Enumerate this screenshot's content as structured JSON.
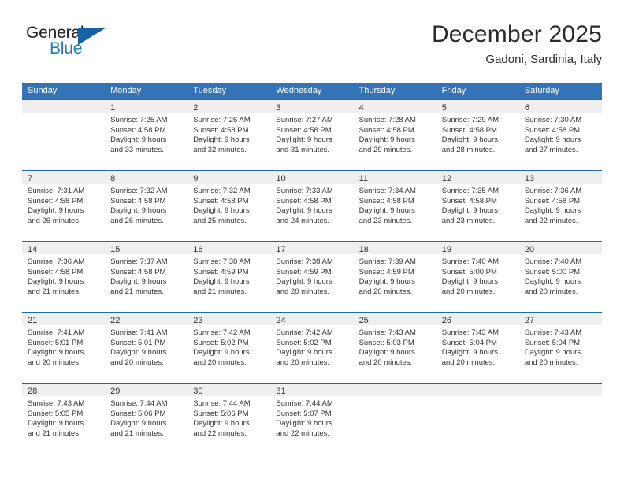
{
  "brand": {
    "word_one": "General",
    "word_two": "Blue",
    "logo_icon": "triangle-logo-icon",
    "accent_color": "#1464a5",
    "blue_text_color": "#1a7bc4"
  },
  "header": {
    "month_title": "December 2025",
    "location": "Gadoni, Sardinia, Italy"
  },
  "colors": {
    "header_row_bg": "#3573b9",
    "row_separator": "#1f6bb0",
    "day_band_bg": "#efefef",
    "text": "#333333"
  },
  "weekdays": [
    "Sunday",
    "Monday",
    "Tuesday",
    "Wednesday",
    "Thursday",
    "Friday",
    "Saturday"
  ],
  "weeks": [
    [
      {
        "day": "",
        "sunrise": "",
        "sunset": "",
        "daylight_line1": "",
        "daylight_line2": ""
      },
      {
        "day": "1",
        "sunrise": "Sunrise: 7:25 AM",
        "sunset": "Sunset: 4:58 PM",
        "daylight_line1": "Daylight: 9 hours",
        "daylight_line2": "and 33 minutes."
      },
      {
        "day": "2",
        "sunrise": "Sunrise: 7:26 AM",
        "sunset": "Sunset: 4:58 PM",
        "daylight_line1": "Daylight: 9 hours",
        "daylight_line2": "and 32 minutes."
      },
      {
        "day": "3",
        "sunrise": "Sunrise: 7:27 AM",
        "sunset": "Sunset: 4:58 PM",
        "daylight_line1": "Daylight: 9 hours",
        "daylight_line2": "and 31 minutes."
      },
      {
        "day": "4",
        "sunrise": "Sunrise: 7:28 AM",
        "sunset": "Sunset: 4:58 PM",
        "daylight_line1": "Daylight: 9 hours",
        "daylight_line2": "and 29 minutes."
      },
      {
        "day": "5",
        "sunrise": "Sunrise: 7:29 AM",
        "sunset": "Sunset: 4:58 PM",
        "daylight_line1": "Daylight: 9 hours",
        "daylight_line2": "and 28 minutes."
      },
      {
        "day": "6",
        "sunrise": "Sunrise: 7:30 AM",
        "sunset": "Sunset: 4:58 PM",
        "daylight_line1": "Daylight: 9 hours",
        "daylight_line2": "and 27 minutes."
      }
    ],
    [
      {
        "day": "7",
        "sunrise": "Sunrise: 7:31 AM",
        "sunset": "Sunset: 4:58 PM",
        "daylight_line1": "Daylight: 9 hours",
        "daylight_line2": "and 26 minutes."
      },
      {
        "day": "8",
        "sunrise": "Sunrise: 7:32 AM",
        "sunset": "Sunset: 4:58 PM",
        "daylight_line1": "Daylight: 9 hours",
        "daylight_line2": "and 26 minutes."
      },
      {
        "day": "9",
        "sunrise": "Sunrise: 7:32 AM",
        "sunset": "Sunset: 4:58 PM",
        "daylight_line1": "Daylight: 9 hours",
        "daylight_line2": "and 25 minutes."
      },
      {
        "day": "10",
        "sunrise": "Sunrise: 7:33 AM",
        "sunset": "Sunset: 4:58 PM",
        "daylight_line1": "Daylight: 9 hours",
        "daylight_line2": "and 24 minutes."
      },
      {
        "day": "11",
        "sunrise": "Sunrise: 7:34 AM",
        "sunset": "Sunset: 4:58 PM",
        "daylight_line1": "Daylight: 9 hours",
        "daylight_line2": "and 23 minutes."
      },
      {
        "day": "12",
        "sunrise": "Sunrise: 7:35 AM",
        "sunset": "Sunset: 4:58 PM",
        "daylight_line1": "Daylight: 9 hours",
        "daylight_line2": "and 23 minutes."
      },
      {
        "day": "13",
        "sunrise": "Sunrise: 7:36 AM",
        "sunset": "Sunset: 4:58 PM",
        "daylight_line1": "Daylight: 9 hours",
        "daylight_line2": "and 22 minutes."
      }
    ],
    [
      {
        "day": "14",
        "sunrise": "Sunrise: 7:36 AM",
        "sunset": "Sunset: 4:58 PM",
        "daylight_line1": "Daylight: 9 hours",
        "daylight_line2": "and 21 minutes."
      },
      {
        "day": "15",
        "sunrise": "Sunrise: 7:37 AM",
        "sunset": "Sunset: 4:58 PM",
        "daylight_line1": "Daylight: 9 hours",
        "daylight_line2": "and 21 minutes."
      },
      {
        "day": "16",
        "sunrise": "Sunrise: 7:38 AM",
        "sunset": "Sunset: 4:59 PM",
        "daylight_line1": "Daylight: 9 hours",
        "daylight_line2": "and 21 minutes."
      },
      {
        "day": "17",
        "sunrise": "Sunrise: 7:38 AM",
        "sunset": "Sunset: 4:59 PM",
        "daylight_line1": "Daylight: 9 hours",
        "daylight_line2": "and 20 minutes."
      },
      {
        "day": "18",
        "sunrise": "Sunrise: 7:39 AM",
        "sunset": "Sunset: 4:59 PM",
        "daylight_line1": "Daylight: 9 hours",
        "daylight_line2": "and 20 minutes."
      },
      {
        "day": "19",
        "sunrise": "Sunrise: 7:40 AM",
        "sunset": "Sunset: 5:00 PM",
        "daylight_line1": "Daylight: 9 hours",
        "daylight_line2": "and 20 minutes."
      },
      {
        "day": "20",
        "sunrise": "Sunrise: 7:40 AM",
        "sunset": "Sunset: 5:00 PM",
        "daylight_line1": "Daylight: 9 hours",
        "daylight_line2": "and 20 minutes."
      }
    ],
    [
      {
        "day": "21",
        "sunrise": "Sunrise: 7:41 AM",
        "sunset": "Sunset: 5:01 PM",
        "daylight_line1": "Daylight: 9 hours",
        "daylight_line2": "and 20 minutes."
      },
      {
        "day": "22",
        "sunrise": "Sunrise: 7:41 AM",
        "sunset": "Sunset: 5:01 PM",
        "daylight_line1": "Daylight: 9 hours",
        "daylight_line2": "and 20 minutes."
      },
      {
        "day": "23",
        "sunrise": "Sunrise: 7:42 AM",
        "sunset": "Sunset: 5:02 PM",
        "daylight_line1": "Daylight: 9 hours",
        "daylight_line2": "and 20 minutes."
      },
      {
        "day": "24",
        "sunrise": "Sunrise: 7:42 AM",
        "sunset": "Sunset: 5:02 PM",
        "daylight_line1": "Daylight: 9 hours",
        "daylight_line2": "and 20 minutes."
      },
      {
        "day": "25",
        "sunrise": "Sunrise: 7:43 AM",
        "sunset": "Sunset: 5:03 PM",
        "daylight_line1": "Daylight: 9 hours",
        "daylight_line2": "and 20 minutes."
      },
      {
        "day": "26",
        "sunrise": "Sunrise: 7:43 AM",
        "sunset": "Sunset: 5:04 PM",
        "daylight_line1": "Daylight: 9 hours",
        "daylight_line2": "and 20 minutes."
      },
      {
        "day": "27",
        "sunrise": "Sunrise: 7:43 AM",
        "sunset": "Sunset: 5:04 PM",
        "daylight_line1": "Daylight: 9 hours",
        "daylight_line2": "and 20 minutes."
      }
    ],
    [
      {
        "day": "28",
        "sunrise": "Sunrise: 7:43 AM",
        "sunset": "Sunset: 5:05 PM",
        "daylight_line1": "Daylight: 9 hours",
        "daylight_line2": "and 21 minutes."
      },
      {
        "day": "29",
        "sunrise": "Sunrise: 7:44 AM",
        "sunset": "Sunset: 5:06 PM",
        "daylight_line1": "Daylight: 9 hours",
        "daylight_line2": "and 21 minutes."
      },
      {
        "day": "30",
        "sunrise": "Sunrise: 7:44 AM",
        "sunset": "Sunset: 5:06 PM",
        "daylight_line1": "Daylight: 9 hours",
        "daylight_line2": "and 22 minutes."
      },
      {
        "day": "31",
        "sunrise": "Sunrise: 7:44 AM",
        "sunset": "Sunset: 5:07 PM",
        "daylight_line1": "Daylight: 9 hours",
        "daylight_line2": "and 22 minutes."
      },
      {
        "day": "",
        "sunrise": "",
        "sunset": "",
        "daylight_line1": "",
        "daylight_line2": ""
      },
      {
        "day": "",
        "sunrise": "",
        "sunset": "",
        "daylight_line1": "",
        "daylight_line2": ""
      },
      {
        "day": "",
        "sunrise": "",
        "sunset": "",
        "daylight_line1": "",
        "daylight_line2": ""
      }
    ]
  ]
}
